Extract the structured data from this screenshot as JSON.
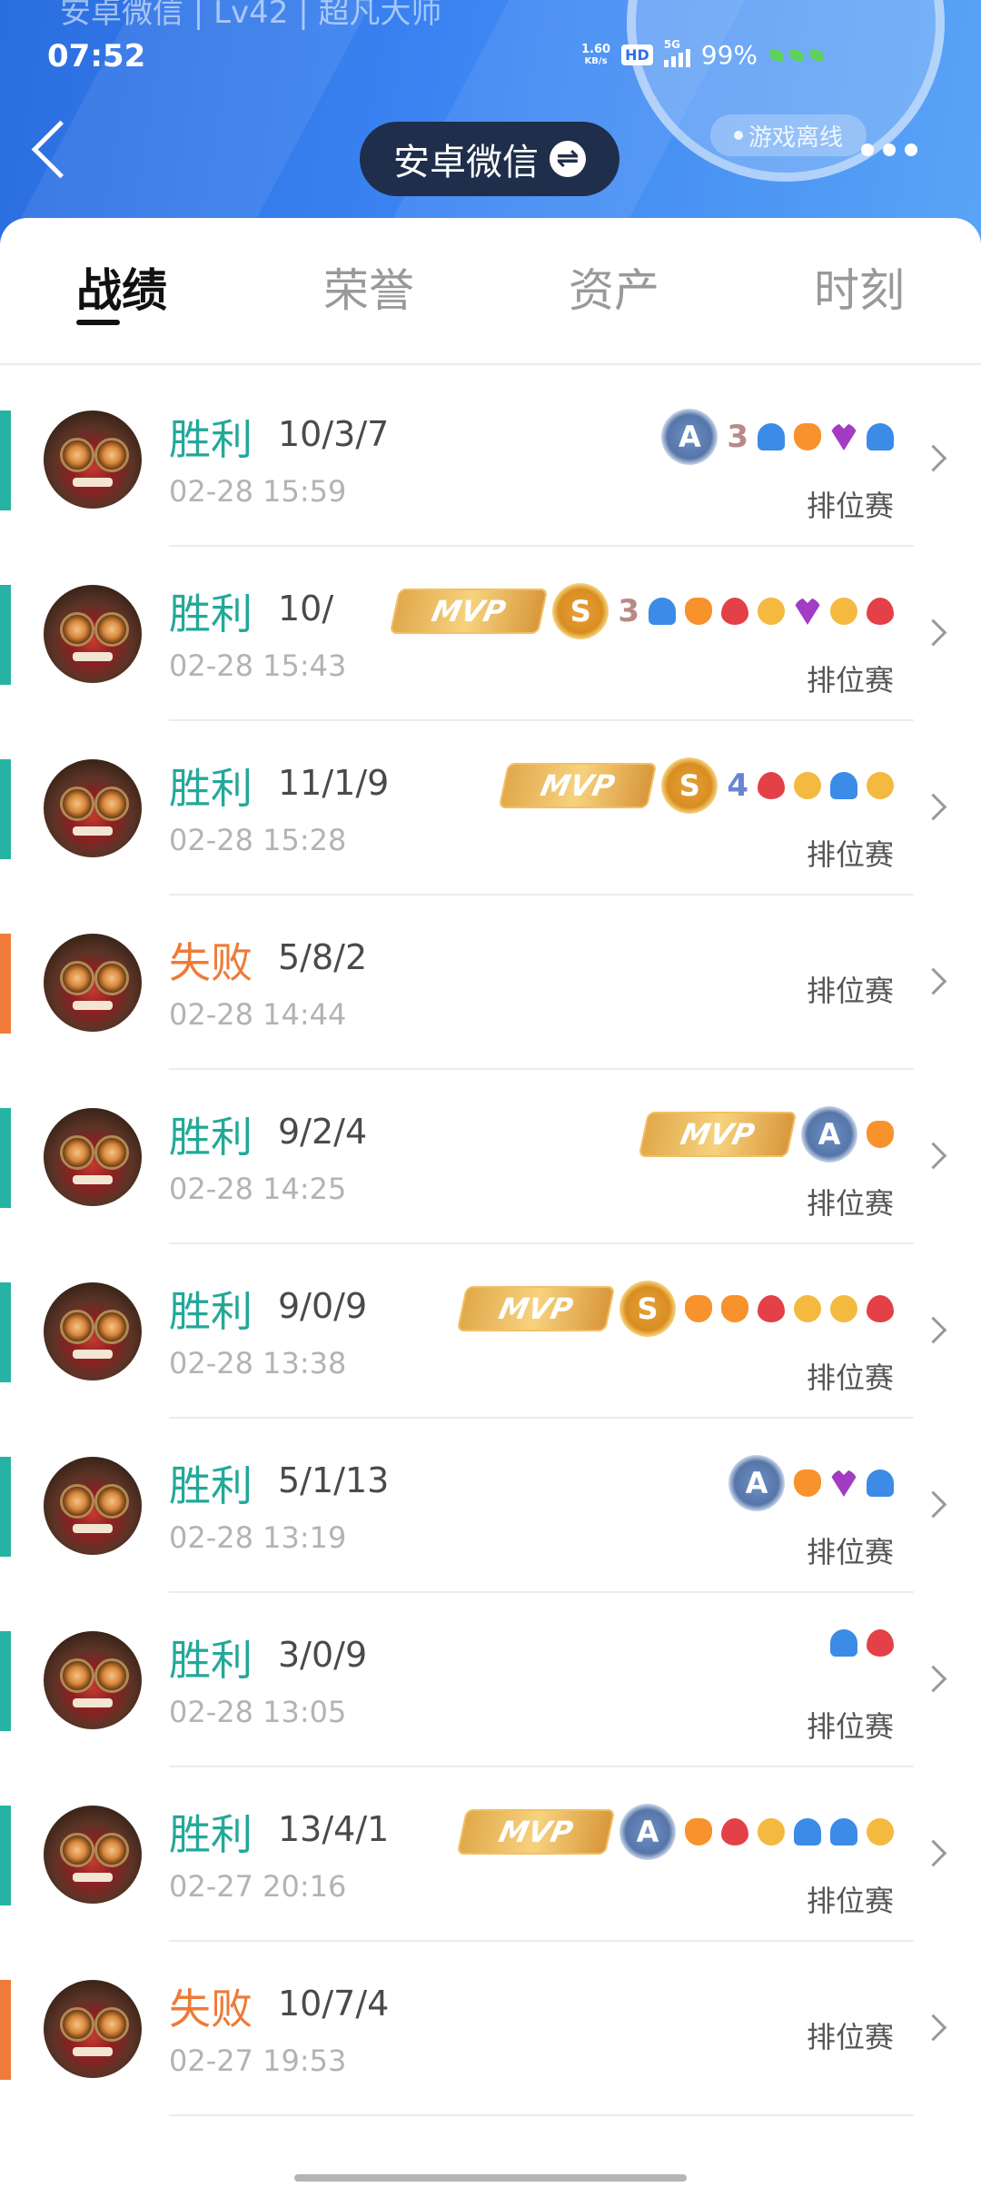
{
  "status_bar": {
    "faded_title": "安卓微信 | Lv42 | 超凡大师",
    "time": "07:52",
    "net_speed_value": "1.60",
    "net_speed_unit": "KB/s",
    "hd": "HD",
    "network": "5G",
    "battery": "99%"
  },
  "header": {
    "account_name": "安卓微信",
    "swap_icon": "⇌",
    "offline_label": "游戏离线"
  },
  "tabs": [
    {
      "label": "战绩",
      "active": true
    },
    {
      "label": "荣誉",
      "active": false
    },
    {
      "label": "资产",
      "active": false
    },
    {
      "label": "时刻",
      "active": false
    }
  ],
  "matches": [
    {
      "result": "胜利",
      "win": true,
      "kda": "10/3/7",
      "time": "02-28 15:59",
      "mode": "排位赛",
      "badges": [
        "medal-A",
        "num-3",
        "icon-blue",
        "icon-orange",
        "icon-purple",
        "icon-blue"
      ]
    },
    {
      "result": "胜利",
      "win": true,
      "kda": "10/",
      "time": "02-28 15:43",
      "mode": "排位赛",
      "badges": [
        "mvp",
        "medal-S",
        "num-3",
        "icon-blue",
        "icon-orange",
        "icon-red",
        "icon-gold",
        "icon-purple",
        "icon-gold",
        "icon-red"
      ]
    },
    {
      "result": "胜利",
      "win": true,
      "kda": "11/1/9",
      "time": "02-28 15:28",
      "mode": "排位赛",
      "badges": [
        "mvp",
        "medal-S",
        "num-4",
        "icon-red",
        "icon-gold",
        "icon-blue",
        "icon-gold"
      ]
    },
    {
      "result": "失败",
      "win": false,
      "kda": "5/8/2",
      "time": "02-28 14:44",
      "mode": "排位赛",
      "badges": []
    },
    {
      "result": "胜利",
      "win": true,
      "kda": "9/2/4",
      "time": "02-28 14:25",
      "mode": "排位赛",
      "badges": [
        "mvp",
        "medal-A",
        "icon-orange"
      ]
    },
    {
      "result": "胜利",
      "win": true,
      "kda": "9/0/9",
      "time": "02-28 13:38",
      "mode": "排位赛",
      "badges": [
        "mvp",
        "medal-S",
        "icon-orange",
        "icon-orange",
        "icon-red",
        "icon-gold",
        "icon-gold",
        "icon-red"
      ]
    },
    {
      "result": "胜利",
      "win": true,
      "kda": "5/1/13",
      "time": "02-28 13:19",
      "mode": "排位赛",
      "badges": [
        "medal-A",
        "icon-orange",
        "icon-purple",
        "icon-blue"
      ]
    },
    {
      "result": "胜利",
      "win": true,
      "kda": "3/0/9",
      "time": "02-28 13:05",
      "mode": "排位赛",
      "badges": [
        "icon-blue",
        "icon-red"
      ]
    },
    {
      "result": "胜利",
      "win": true,
      "kda": "13/4/1",
      "time": "02-27 20:16",
      "mode": "排位赛",
      "badges": [
        "mvp",
        "medal-A",
        "icon-orange",
        "icon-red",
        "icon-gold",
        "icon-blue",
        "icon-blue",
        "icon-gold"
      ]
    },
    {
      "result": "失败",
      "win": false,
      "kda": "10/7/4",
      "time": "02-27 19:53",
      "mode": "排位赛",
      "badges": []
    }
  ],
  "badge_text": {
    "mvp": "MVP",
    "A": "A",
    "S": "S",
    "num-3": "3",
    "num-4": "4"
  },
  "colors": {
    "win": "#23a898",
    "loss": "#ef7a35",
    "header_start": "#2a6de0",
    "header_end": "#5aa4f6"
  }
}
